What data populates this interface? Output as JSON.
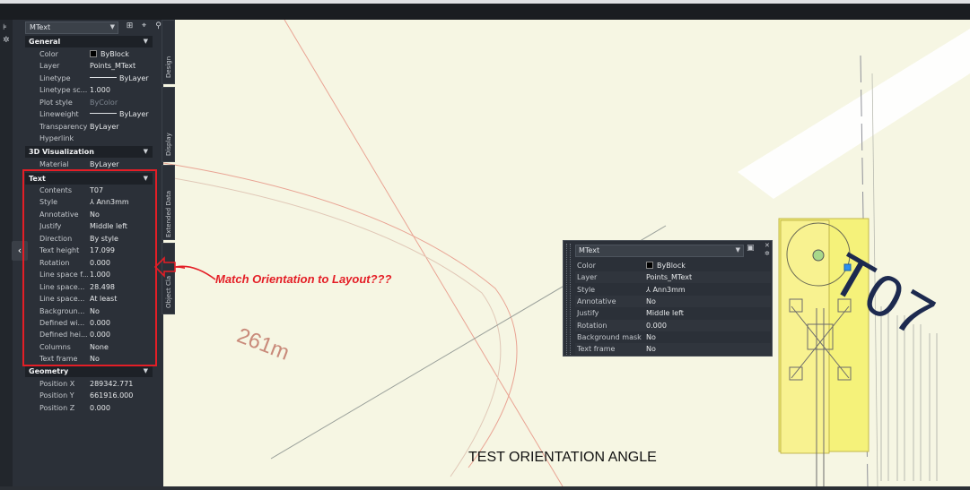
{
  "palette": {
    "object_type": "MText",
    "sections": {
      "general": "General",
      "viz3d": "3D Visualization",
      "text": "Text",
      "geometry": "Geometry"
    },
    "general_rows": [
      {
        "label": "Color",
        "value": "ByBlock"
      },
      {
        "label": "Layer",
        "value": "Points_MText"
      },
      {
        "label": "Linetype",
        "value": "ByLayer"
      },
      {
        "label": "Linetype sc...",
        "value": "1.000"
      },
      {
        "label": "Plot style",
        "value": "ByColor"
      },
      {
        "label": "Lineweight",
        "value": "ByLayer"
      },
      {
        "label": "Transparency",
        "value": "ByLayer"
      },
      {
        "label": "Hyperlink",
        "value": ""
      }
    ],
    "viz3d_rows": [
      {
        "label": "Material",
        "value": "ByLayer"
      }
    ],
    "text_rows": [
      {
        "label": "Contents",
        "value": "T07"
      },
      {
        "label": "Style",
        "value": "Ann3mm"
      },
      {
        "label": "Annotative",
        "value": "No"
      },
      {
        "label": "Justify",
        "value": "Middle left"
      },
      {
        "label": "Direction",
        "value": "By style"
      },
      {
        "label": "Text height",
        "value": "17.099"
      },
      {
        "label": "Rotation",
        "value": "0.000"
      },
      {
        "label": "Line space f...",
        "value": "1.000"
      },
      {
        "label": "Line space...",
        "value": "28.498"
      },
      {
        "label": "Line space...",
        "value": "At least"
      },
      {
        "label": "Backgroun...",
        "value": "No"
      },
      {
        "label": "Defined wi...",
        "value": "0.000"
      },
      {
        "label": "Defined hei...",
        "value": "0.000"
      },
      {
        "label": "Columns",
        "value": "None"
      },
      {
        "label": "Text frame",
        "value": "No"
      }
    ],
    "geometry_rows": [
      {
        "label": "Position X",
        "value": "289342.771"
      },
      {
        "label": "Position Y",
        "value": "661916.000"
      },
      {
        "label": "Position Z",
        "value": "0.000"
      }
    ],
    "tabs": [
      "Design",
      "Display",
      "Extended Data",
      "Object Cla"
    ]
  },
  "annotation": "Match Orientation to Layout???",
  "canvas": {
    "distance_label": "261m",
    "point_label": "T07",
    "caption": "TEST ORIENTATION ANGLE"
  },
  "quick_props": {
    "object_type": "MText",
    "rows": [
      {
        "label": "Color",
        "value": "ByBlock"
      },
      {
        "label": "Layer",
        "value": "Points_MText"
      },
      {
        "label": "Style",
        "value": "Ann3mm"
      },
      {
        "label": "Annotative",
        "value": "No"
      },
      {
        "label": "Justify",
        "value": "Middle left"
      },
      {
        "label": "Rotation",
        "value": "0.000"
      },
      {
        "label": "Background mask",
        "value": "No"
      },
      {
        "label": "Text frame",
        "value": "No"
      }
    ]
  },
  "colors": {
    "highlight": "#e41e26",
    "canvas_bg": "#f6f6e3",
    "building_fill": "#f5f27a",
    "label_text": "#1d2a4f",
    "grip": "#2a8ff0"
  },
  "icons": {
    "select_objects": "select-objects-icon",
    "quick_select": "quick-select-icon",
    "toggle_pickadd": "toggle-pickadd-icon",
    "collapse": "chevron-left-icon"
  }
}
